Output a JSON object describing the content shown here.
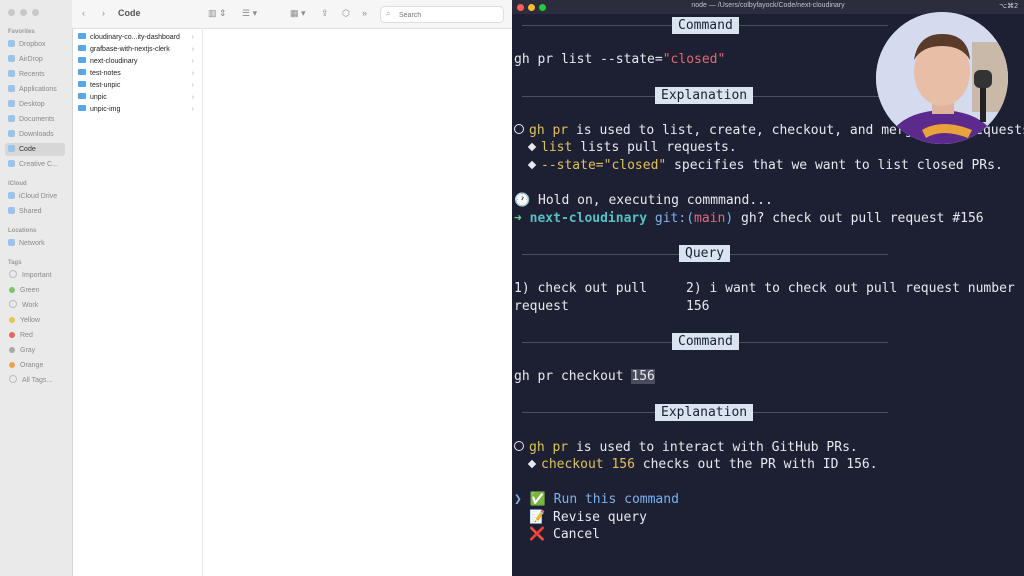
{
  "finder": {
    "folder_title": "Code",
    "search_placeholder": "Search",
    "sidebar": {
      "favorites_header": "Favorites",
      "favorites": [
        "Dropbox",
        "AirDrop",
        "Recents",
        "Applications",
        "Desktop",
        "Documents",
        "Downloads",
        "Code",
        "Creative C..."
      ],
      "icloud_header": "iCloud",
      "icloud": [
        "iCloud Drive",
        "Shared"
      ],
      "locations_header": "Locations",
      "locations": [
        "Network"
      ],
      "tags_header": "Tags",
      "tags": [
        {
          "label": "Important",
          "color": "#d8d8d8"
        },
        {
          "label": "Green",
          "color": "#7dc46a"
        },
        {
          "label": "Work",
          "color": "#d8d8d8"
        },
        {
          "label": "Yellow",
          "color": "#e6c650"
        },
        {
          "label": "Red",
          "color": "#e5645c"
        },
        {
          "label": "Gray",
          "color": "#a8a8a8"
        },
        {
          "label": "Orange",
          "color": "#eea24f"
        },
        {
          "label": "All Tags..."
        }
      ]
    },
    "files": [
      "cloudinary-co...ity-dashboard",
      "grafbase-with-nextjs-clerk",
      "next-cloudinary",
      "test-notes",
      "test-unpic",
      "unpic",
      "unpic-img"
    ]
  },
  "terminal": {
    "title": "node — /Users/colbyfayock/Code/next-cloudinary",
    "shortcut": "⌥⌘2",
    "header_command": "Command",
    "header_explanation": "Explanation",
    "header_query": "Query",
    "cmd1_prefix": "gh pr list --state=",
    "cmd1_arg": "\"closed\"",
    "exp1_cmd": "gh pr",
    "exp1_text": " is used to list, create, checkout, and merge pull requests.",
    "exp1_sub1_kw": "list",
    "exp1_sub1_text": " lists pull requests.",
    "exp1_sub2_kw": "--state=\"closed\"",
    "exp1_sub2_text": " specifies that we want to list closed PRs.",
    "hold_on_icon": "🕐",
    "hold_on": "Hold on, executing commmand...",
    "prompt_arrow": "➜",
    "prompt_dir": "next-cloudinary",
    "prompt_git": "git:(",
    "prompt_branch": "main",
    "prompt_git_close": ")",
    "prompt_cmd": " gh? check out pull request #156",
    "query1_line1": "1) check out pull",
    "query1_line2": "request",
    "query2_line1": "2) i want to check out pull request number",
    "query2_line2": "156",
    "cmd2_prefix": "gh pr checkout ",
    "cmd2_arg": "156",
    "exp2_cmd": "gh pr",
    "exp2_text": " is used to interact with GitHub PRs.",
    "exp2_sub1_kw": "checkout 156",
    "exp2_sub1_text": " checks out the PR with ID 156.",
    "menu_pointer": "❯",
    "menu": [
      {
        "icon": "✅",
        "label": "Run this command"
      },
      {
        "icon": "📝",
        "label": "Revise query"
      },
      {
        "icon": "❌",
        "label": "Cancel"
      }
    ]
  }
}
